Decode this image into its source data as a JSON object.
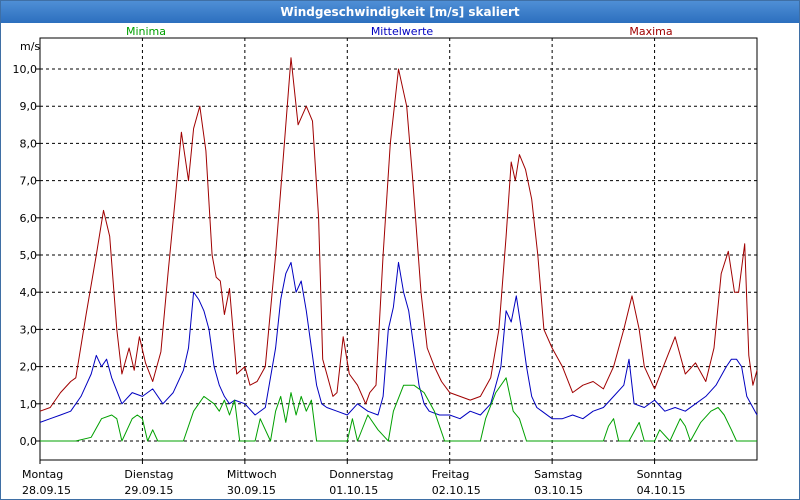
{
  "window": {
    "title": "Windgeschwindigkeit [m/s] skaliert"
  },
  "legend": {
    "min_label": "Minima",
    "mean_label": "Mittelwerte",
    "max_label": "Maxima"
  },
  "colors": {
    "min": "#00a000",
    "mean": "#0000c0",
    "max": "#a00000",
    "grid": "#000000"
  },
  "chart_data": {
    "type": "line",
    "title": "Windgeschwindigkeit [m/s] skaliert",
    "ylabel": "m/s",
    "xlabel": "",
    "ylim": [
      0,
      10.8
    ],
    "xlim": [
      0,
      7
    ],
    "grid": true,
    "legend_position": "top",
    "yticks": [
      "0,0",
      "1,0",
      "2,0",
      "3,0",
      "4,0",
      "5,0",
      "6,0",
      "7,0",
      "8,0",
      "9,0",
      "10,0"
    ],
    "days": [
      {
        "name": "Montag",
        "date": "28.09.15"
      },
      {
        "name": "Dienstag",
        "date": "29.09.15"
      },
      {
        "name": "Mittwoch",
        "date": "30.09.15"
      },
      {
        "name": "Donnerstag",
        "date": "01.10.15"
      },
      {
        "name": "Freitag",
        "date": "02.10.15"
      },
      {
        "name": "Samstag",
        "date": "03.10.15"
      },
      {
        "name": "Sonntag",
        "date": "04.10.15"
      }
    ],
    "series": [
      {
        "name": "Maxima",
        "x": [
          0,
          0.1,
          0.2,
          0.3,
          0.35,
          0.45,
          0.55,
          0.62,
          0.68,
          0.75,
          0.8,
          0.87,
          0.92,
          0.97,
          1.03,
          1.1,
          1.18,
          1.25,
          1.32,
          1.38,
          1.45,
          1.5,
          1.56,
          1.62,
          1.68,
          1.72,
          1.76,
          1.8,
          1.85,
          1.92,
          2.0,
          2.05,
          2.12,
          2.2,
          2.3,
          2.38,
          2.45,
          2.52,
          2.6,
          2.66,
          2.72,
          2.76,
          2.8,
          2.86,
          2.9,
          2.96,
          3.02,
          3.1,
          3.18,
          3.22,
          3.28,
          3.35,
          3.42,
          3.5,
          3.58,
          3.64,
          3.72,
          3.78,
          3.85,
          3.92,
          4.0,
          4.1,
          4.2,
          4.3,
          4.4,
          4.48,
          4.55,
          4.6,
          4.64,
          4.68,
          4.74,
          4.8,
          4.86,
          4.92,
          5.0,
          5.1,
          5.2,
          5.3,
          5.4,
          5.5,
          5.6,
          5.7,
          5.78,
          5.85,
          5.9,
          6.0,
          6.1,
          6.2,
          6.3,
          6.4,
          6.5,
          6.58,
          6.65,
          6.72,
          6.78,
          6.82,
          6.88,
          6.92,
          6.96,
          7.0
        ],
        "values": [
          0.8,
          0.9,
          1.3,
          1.6,
          1.7,
          3.4,
          5.0,
          6.2,
          5.5,
          3.0,
          1.8,
          2.5,
          1.9,
          2.8,
          2.1,
          1.6,
          2.4,
          4.5,
          6.5,
          8.3,
          7.0,
          8.4,
          9.0,
          7.8,
          5.0,
          4.4,
          4.3,
          3.4,
          4.1,
          1.8,
          2.0,
          1.5,
          1.6,
          2.0,
          5.0,
          7.8,
          10.3,
          8.5,
          9.0,
          8.6,
          6.0,
          2.2,
          1.8,
          1.2,
          1.3,
          2.8,
          1.8,
          1.5,
          1.0,
          1.3,
          1.5,
          5.0,
          8.0,
          10.0,
          9.0,
          7.0,
          4.0,
          2.5,
          2.0,
          1.6,
          1.3,
          1.2,
          1.1,
          1.2,
          1.7,
          3.0,
          5.5,
          7.5,
          7.0,
          7.7,
          7.3,
          6.5,
          5.0,
          3.0,
          2.5,
          2.0,
          1.3,
          1.5,
          1.6,
          1.4,
          2.0,
          3.0,
          3.9,
          3.0,
          2.0,
          1.4,
          2.1,
          2.8,
          1.8,
          2.1,
          1.6,
          2.5,
          4.5,
          5.1,
          4.0,
          4.0,
          5.3,
          2.3,
          1.5,
          1.9
        ]
      },
      {
        "name": "Mittelwerte",
        "x": [
          0,
          0.1,
          0.2,
          0.3,
          0.4,
          0.5,
          0.55,
          0.6,
          0.65,
          0.7,
          0.8,
          0.9,
          1.0,
          1.1,
          1.2,
          1.3,
          1.4,
          1.45,
          1.5,
          1.55,
          1.6,
          1.65,
          1.7,
          1.75,
          1.8,
          1.85,
          1.9,
          2.0,
          2.1,
          2.2,
          2.3,
          2.35,
          2.4,
          2.45,
          2.5,
          2.55,
          2.6,
          2.65,
          2.7,
          2.75,
          2.8,
          2.9,
          3.0,
          3.1,
          3.2,
          3.3,
          3.35,
          3.4,
          3.45,
          3.5,
          3.55,
          3.6,
          3.65,
          3.7,
          3.75,
          3.8,
          3.9,
          4.0,
          4.1,
          4.2,
          4.3,
          4.4,
          4.5,
          4.55,
          4.6,
          4.65,
          4.7,
          4.75,
          4.8,
          4.85,
          4.9,
          5.0,
          5.1,
          5.2,
          5.3,
          5.4,
          5.5,
          5.6,
          5.7,
          5.75,
          5.8,
          5.9,
          6.0,
          6.1,
          6.2,
          6.3,
          6.4,
          6.5,
          6.6,
          6.7,
          6.75,
          6.8,
          6.85,
          6.9,
          7.0
        ],
        "values": [
          0.5,
          0.6,
          0.7,
          0.8,
          1.2,
          1.8,
          2.3,
          2.0,
          2.2,
          1.7,
          1.0,
          1.3,
          1.2,
          1.4,
          1.0,
          1.3,
          1.9,
          2.5,
          4.0,
          3.8,
          3.5,
          3.0,
          2.0,
          1.5,
          1.2,
          1.0,
          1.1,
          1.0,
          0.7,
          0.9,
          2.5,
          3.8,
          4.5,
          4.8,
          4.0,
          4.3,
          3.5,
          2.5,
          1.5,
          1.0,
          0.9,
          0.8,
          0.7,
          1.0,
          0.8,
          0.7,
          1.2,
          3.0,
          3.6,
          4.8,
          4.0,
          3.5,
          2.5,
          1.5,
          1.0,
          0.8,
          0.7,
          0.7,
          0.6,
          0.8,
          0.7,
          1.0,
          2.0,
          3.5,
          3.2,
          3.9,
          3.0,
          2.0,
          1.2,
          0.9,
          0.8,
          0.6,
          0.6,
          0.7,
          0.6,
          0.8,
          0.9,
          1.2,
          1.5,
          2.2,
          1.0,
          0.9,
          1.1,
          0.8,
          0.9,
          0.8,
          1.0,
          1.2,
          1.5,
          2.0,
          2.2,
          2.2,
          2.0,
          1.2,
          0.7
        ]
      },
      {
        "name": "Minima",
        "x": [
          0,
          0.35,
          0.5,
          0.6,
          0.7,
          0.75,
          0.8,
          0.9,
          0.95,
          1.0,
          1.05,
          1.1,
          1.15,
          1.2,
          1.4,
          1.5,
          1.6,
          1.7,
          1.75,
          1.8,
          1.85,
          1.9,
          1.95,
          2.0,
          2.1,
          2.15,
          2.25,
          2.3,
          2.35,
          2.4,
          2.45,
          2.5,
          2.55,
          2.6,
          2.65,
          2.7,
          2.8,
          2.9,
          3.0,
          3.05,
          3.1,
          3.2,
          3.3,
          3.4,
          3.45,
          3.55,
          3.65,
          3.75,
          3.85,
          3.95,
          4.0,
          4.3,
          4.35,
          4.45,
          4.55,
          4.62,
          4.68,
          4.75,
          4.85,
          4.9,
          5.0,
          5.2,
          5.5,
          5.55,
          5.6,
          5.65,
          5.75,
          5.85,
          5.9,
          6.0,
          6.05,
          6.15,
          6.25,
          6.3,
          6.35,
          6.45,
          6.55,
          6.62,
          6.68,
          6.75,
          6.8,
          6.85,
          6.9,
          7.0
        ],
        "values": [
          0.0,
          0.0,
          0.1,
          0.6,
          0.7,
          0.6,
          0.0,
          0.6,
          0.7,
          0.6,
          0.0,
          0.3,
          0.0,
          0.0,
          0.0,
          0.8,
          1.2,
          1.0,
          0.8,
          1.1,
          0.7,
          1.1,
          0.0,
          0.0,
          0.0,
          0.6,
          0.0,
          0.8,
          1.2,
          0.5,
          1.3,
          0.7,
          1.2,
          0.8,
          1.1,
          0.0,
          0.0,
          0.0,
          0.0,
          0.6,
          0.0,
          0.7,
          0.3,
          0.0,
          0.8,
          1.5,
          1.5,
          1.3,
          0.8,
          0.0,
          0.0,
          0.0,
          0.6,
          1.3,
          1.7,
          0.8,
          0.6,
          0.0,
          0.0,
          0.0,
          0.0,
          0.0,
          0.0,
          0.4,
          0.6,
          0.0,
          0.0,
          0.5,
          0.0,
          0.0,
          0.3,
          0.0,
          0.6,
          0.4,
          0.0,
          0.5,
          0.8,
          0.9,
          0.7,
          0.3,
          0.0,
          0.0,
          0.0,
          0.0
        ]
      }
    ]
  }
}
